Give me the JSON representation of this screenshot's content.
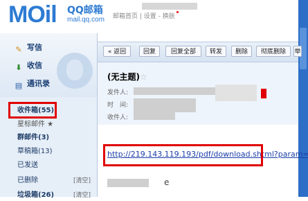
{
  "logo": {
    "mail_text": "MOil",
    "qq_text": "QQ邮箱",
    "domain_text": "mail.qq.com"
  },
  "top_links": {
    "home": "邮箱首页",
    "settings": "设置",
    "switch": "换肤"
  },
  "sidebar": {
    "tools": [
      {
        "label": "写信",
        "icon": "pencil-icon"
      },
      {
        "label": "收信",
        "icon": "inbox-arrow-icon"
      },
      {
        "label": "通讯录",
        "icon": "address-book-icon"
      }
    ],
    "folders": [
      {
        "label": "收件箱(55)",
        "bold": true
      },
      {
        "label": "星标邮件 ★",
        "bold": false
      },
      {
        "label": "群邮件(3)",
        "bold": true
      },
      {
        "label": "草稿箱(13)",
        "bold": false
      },
      {
        "label": "已发送",
        "bold": false
      },
      {
        "label": "已删除",
        "bold": false,
        "clear": "[清空]"
      },
      {
        "label": "垃圾箱(26)",
        "bold": true,
        "clear": "[清空]"
      }
    ]
  },
  "toolbar": {
    "back": "« 返回",
    "reply": "回复",
    "reply_all": "回复全部",
    "forward": "转发",
    "delete": "删除",
    "delete_permanently": "彻底删除",
    "more": "举"
  },
  "message": {
    "subject": "(无主题)",
    "star": "☆",
    "from_label": "发件人:",
    "time_label": "时　间:",
    "to_label": "收件人:",
    "link_text": "http://219.143.119.193/pdf/download.shtml?param=",
    "body_tail": "e"
  },
  "colors": {
    "brand_blue": "#2d7bd3",
    "highlight_red": "#e00000",
    "sidebar_bg": "#e6eef8",
    "link_blue": "#1a3ea8"
  }
}
